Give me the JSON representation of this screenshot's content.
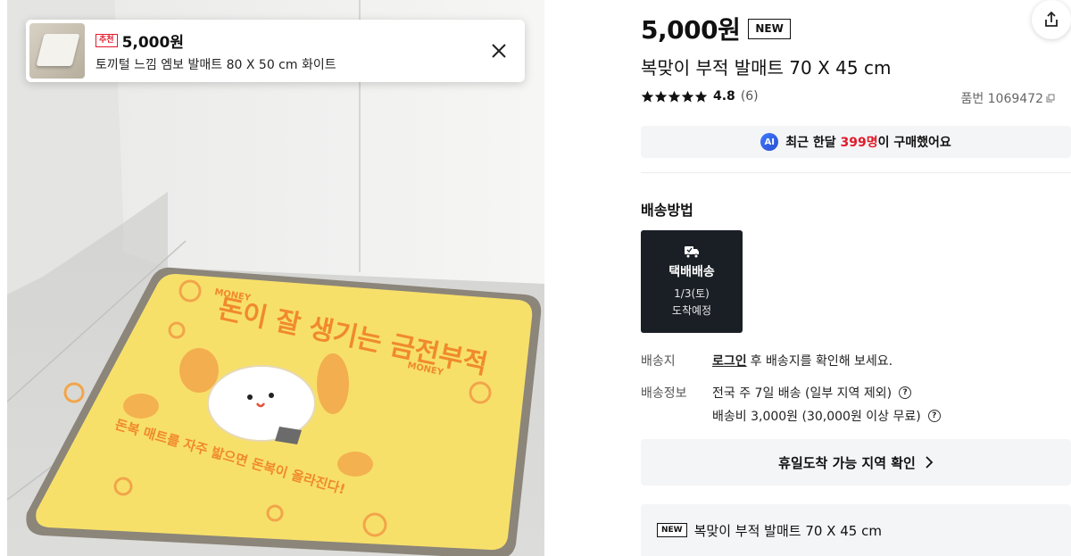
{
  "recommendation": {
    "badge": "추천",
    "price": "5,000원",
    "name": "토끼털 느낌 엠보 발매트 80 X 50 cm 화이트"
  },
  "product": {
    "price": "5,000원",
    "badge": "NEW",
    "title": "복맞이 부적 발매트 70 X 45 cm",
    "rating": "4.8",
    "rating_count": "(6)",
    "rating_stars": 5,
    "sku": "품번 1069472"
  },
  "ai_bar": {
    "icon_label": "AI",
    "prefix": "최근 한달 ",
    "highlight": "399명",
    "suffix": "이 구매했어요"
  },
  "delivery": {
    "section_title": "배송방법",
    "method_name": "택배배송",
    "method_date": "1/3(토)",
    "method_note": "도착예정",
    "address_label": "배송지",
    "login_link": "로그인",
    "address_text": "후 배송지를 확인해 보세요.",
    "info_label": "배송정보",
    "info_line1": "전국 주 7일 배송 (일부 지역 제외)",
    "info_line2": "배송비 3,000원 (30,000원 이상 무료)"
  },
  "holiday_button": "휴일도착 가능 지역 확인",
  "option": {
    "badge": "NEW",
    "name": "복맞이 부적 발매트 70 X 45 cm"
  },
  "mat_artwork": {
    "headline": "돈이 잘 생기는 금전부적",
    "subline": "돈복 매트를 자주 밟으면 돈복이 올라진다!",
    "money_left": "MONEY",
    "money_right": "MONEY"
  },
  "colors": {
    "accent_red": "#e11a2b",
    "dark_card": "#1a1f26",
    "mat_yellow": "#f7e06a",
    "mat_orange": "#f2a54a"
  }
}
